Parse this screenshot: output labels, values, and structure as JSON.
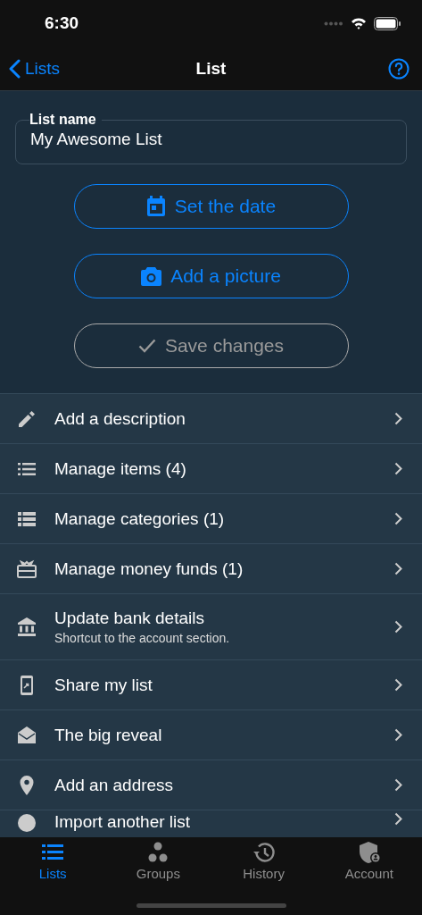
{
  "status_bar": {
    "time": "6:30"
  },
  "nav": {
    "back": "Lists",
    "title": "List"
  },
  "form": {
    "name_field": {
      "label": "List name",
      "value": "My Awesome List"
    },
    "buttons": [
      {
        "label": "Set the date",
        "disabled": false
      },
      {
        "label": "Add a picture",
        "disabled": false
      },
      {
        "label": "Save changes",
        "disabled": true
      }
    ]
  },
  "menu": [
    {
      "title": "Add a description"
    },
    {
      "title": "Manage items (4)"
    },
    {
      "title": "Manage categories (1)"
    },
    {
      "title": "Manage money funds (1)"
    },
    {
      "title": "Update bank details",
      "subtitle": "Shortcut to the account section."
    },
    {
      "title": "Share my list"
    },
    {
      "title": "The big reveal"
    },
    {
      "title": "Add an address"
    },
    {
      "title": "Import another list"
    }
  ],
  "tabs": [
    {
      "label": "Lists",
      "selected": true
    },
    {
      "label": "Groups",
      "selected": false
    },
    {
      "label": "History",
      "selected": false
    },
    {
      "label": "Account",
      "selected": false
    }
  ]
}
